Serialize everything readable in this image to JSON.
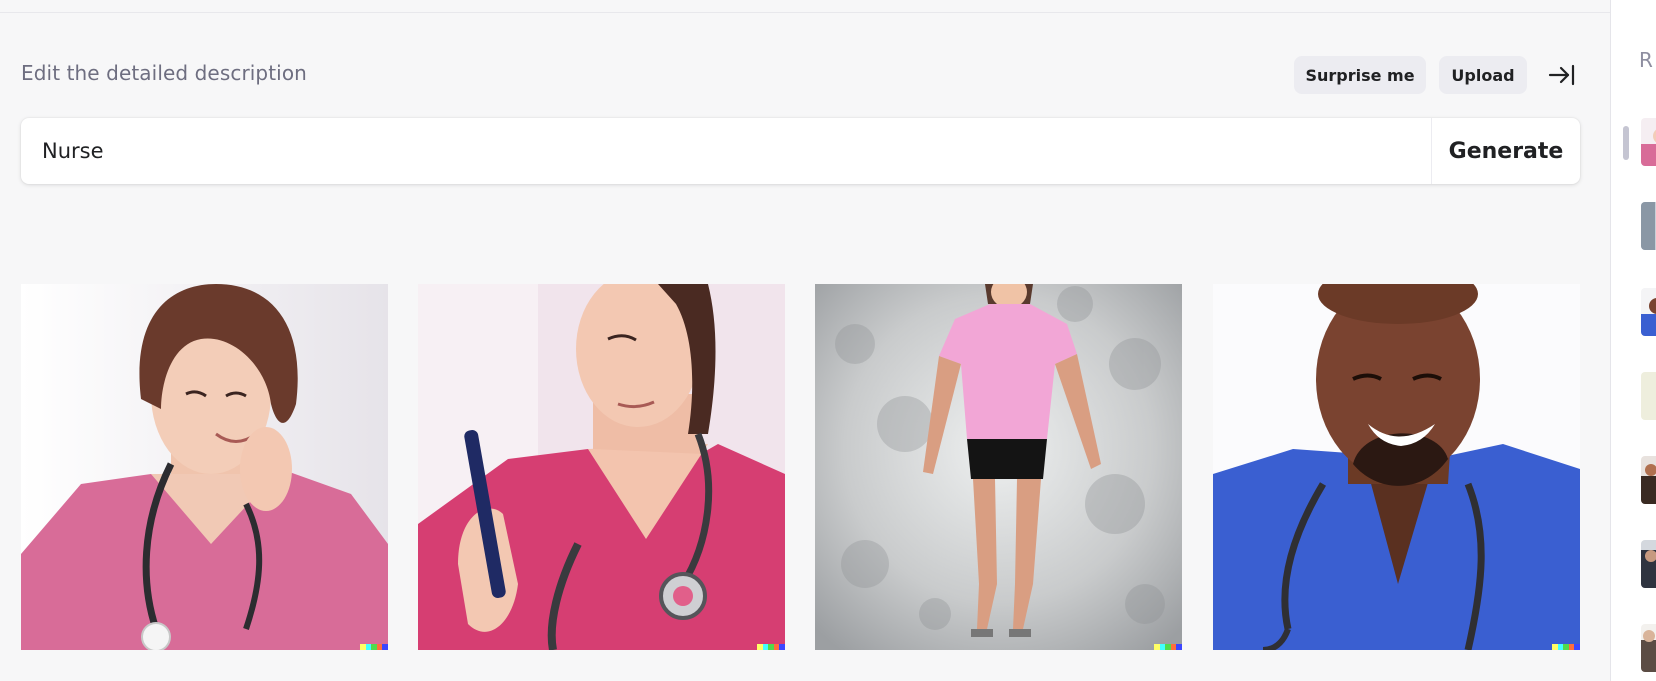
{
  "prompt": {
    "label": "Edit the detailed description",
    "value": "Nurse",
    "generate_label": "Generate",
    "surprise_label": "Surprise me",
    "upload_label": "Upload",
    "collapse_icon": "collapse-sidebar-icon"
  },
  "results": [
    {
      "alt": "woman in pink scrubs with stethoscope",
      "scrub_color": "#d86c98",
      "bg": "#f1eef1"
    },
    {
      "alt": "woman in magenta scrubs holding pen",
      "scrub_color": "#d63e72",
      "bg": "#f1e4ec"
    },
    {
      "alt": "woman in pink top and black skirt",
      "scrub_color": "#f0a8d4",
      "bg": "#b9bbbd"
    },
    {
      "alt": "smiling man in blue scrubs with stethoscope",
      "scrub_color": "#3a5fd1",
      "bg": "#f7f7f9"
    }
  ],
  "sidebar": {
    "title": "R",
    "thumbnail_count": 7
  },
  "colors": {
    "accent": "#202123",
    "muted": "#6e6e80",
    "button_bg": "#ececf1"
  }
}
